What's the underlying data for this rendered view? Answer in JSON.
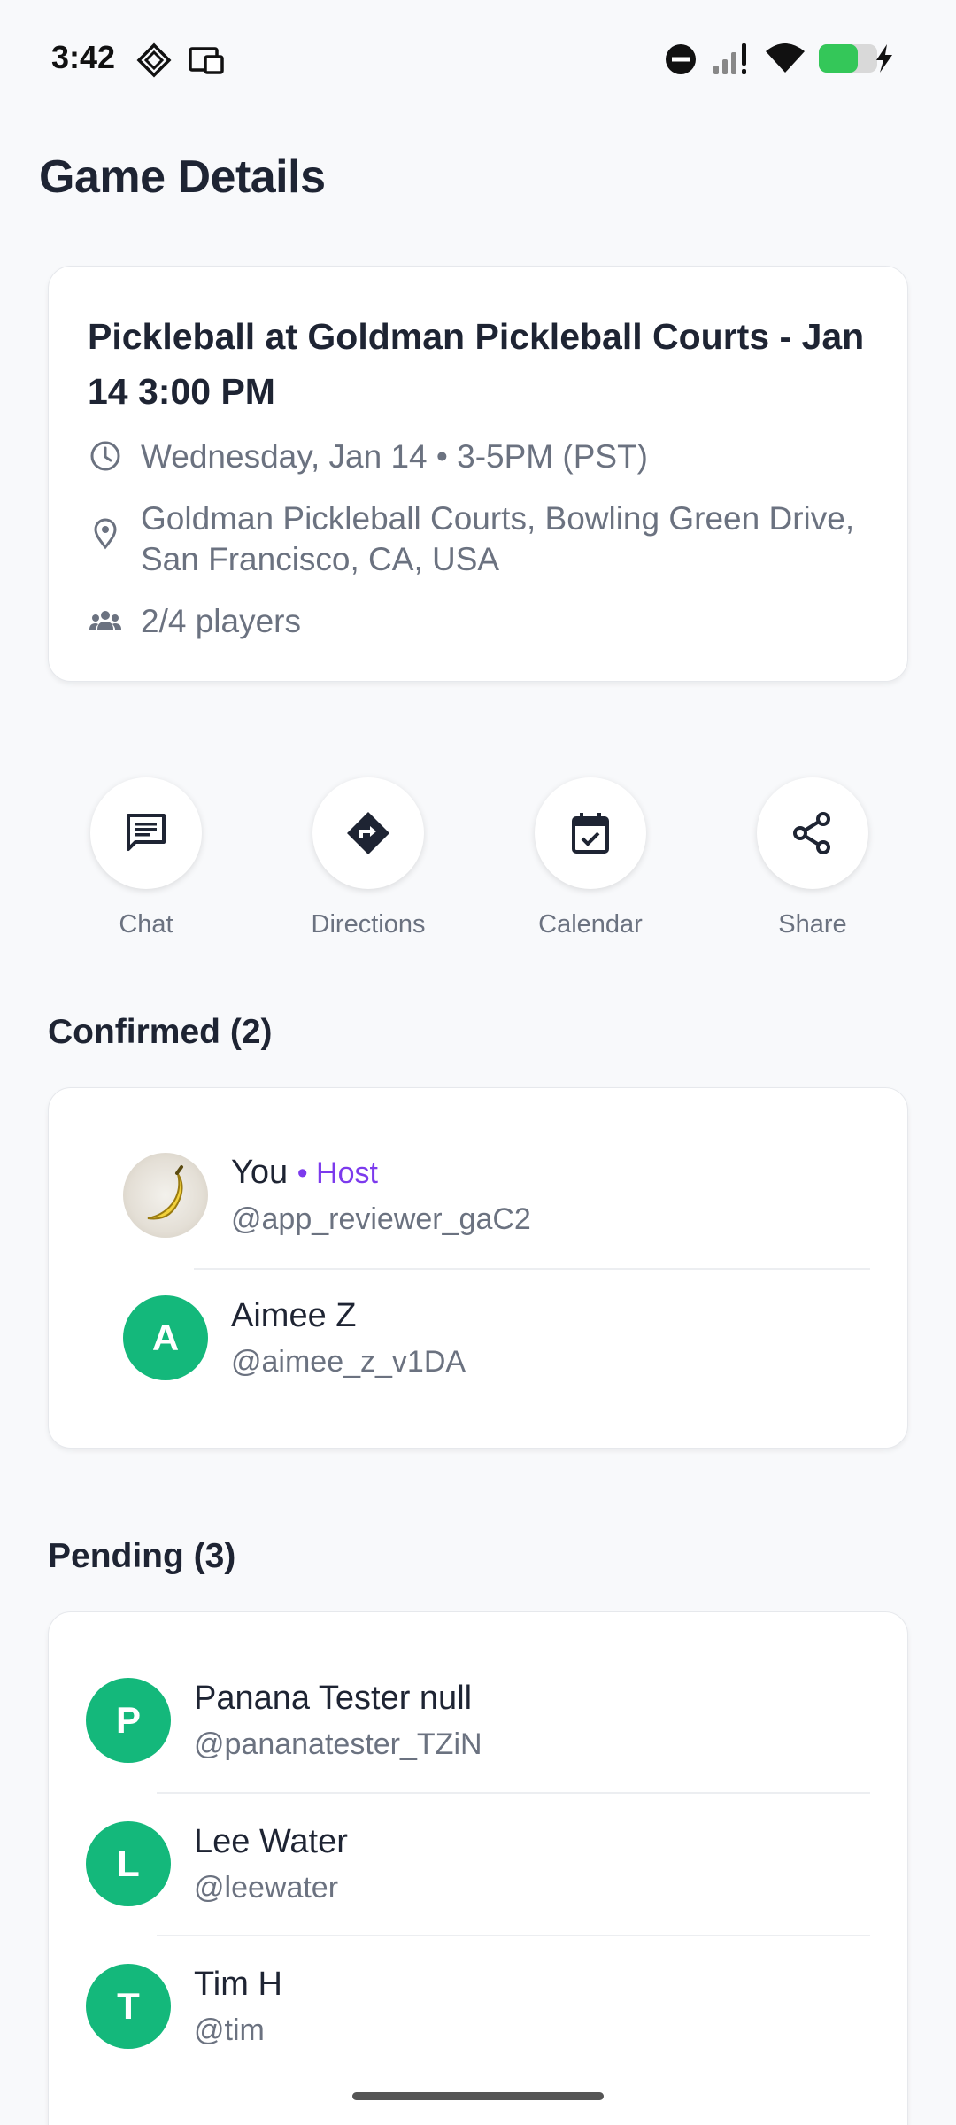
{
  "status_bar": {
    "time": "3:42",
    "icons": [
      "location-diamond-icon",
      "cast-icon",
      "dnd-icon",
      "signal-icon",
      "wifi-icon",
      "battery-charging-icon"
    ]
  },
  "page": {
    "title": "Game Details"
  },
  "game": {
    "title": "Pickleball at Goldman Pickleball Courts - Jan 14 3:00 PM",
    "datetime": "Wednesday, Jan 14 • 3-5PM (PST)",
    "location": "Goldman Pickleball Courts, Bowling Green Drive, San Francisco, CA, USA",
    "players": "2/4 players"
  },
  "actions": [
    {
      "label": "Chat",
      "icon": "chat-icon"
    },
    {
      "label": "Directions",
      "icon": "directions-icon"
    },
    {
      "label": "Calendar",
      "icon": "calendar-icon"
    },
    {
      "label": "Share",
      "icon": "share-icon"
    }
  ],
  "confirmed": {
    "title": "Confirmed (2)",
    "people": [
      {
        "name": "You",
        "tag": "• Host",
        "handle": "@app_reviewer_gaC2",
        "avatar": "banana-photo"
      },
      {
        "name": "Aimee Z",
        "handle": "@aimee_z_v1DA",
        "initial": "A"
      }
    ]
  },
  "pending": {
    "title": "Pending (3)",
    "people": [
      {
        "name": "Panana Tester null",
        "handle": "@pananatester_TZiN",
        "initial": "P"
      },
      {
        "name": "Lee Water",
        "handle": "@leewater",
        "initial": "L"
      },
      {
        "name": "Tim H",
        "handle": "@tim",
        "initial": "T"
      }
    ]
  },
  "colors": {
    "accent_green": "#14b87b",
    "host_purple": "#7c3aed",
    "text_dark": "#1e2433",
    "text_muted": "#6b7280"
  }
}
